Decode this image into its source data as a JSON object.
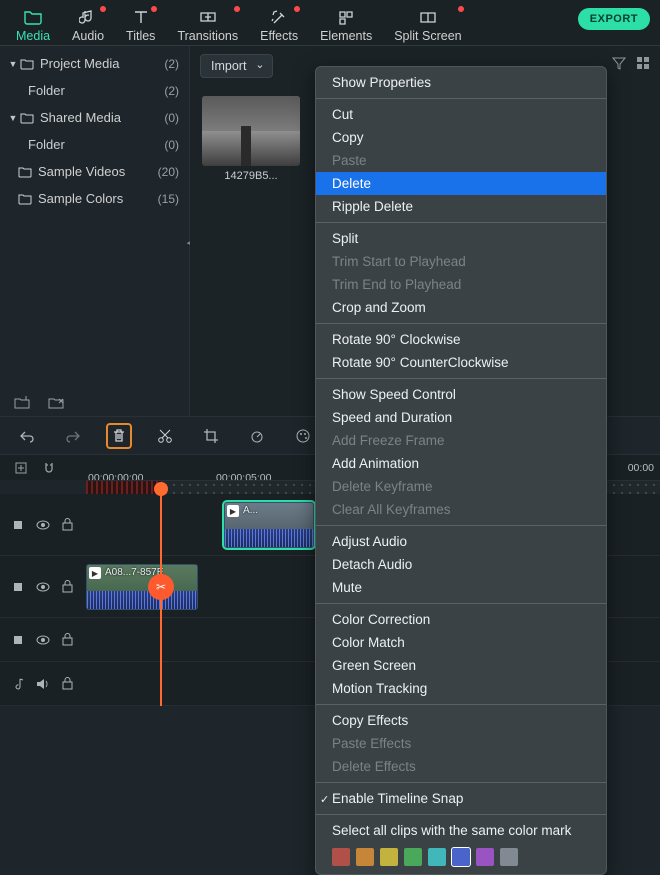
{
  "top": {
    "tabs": [
      {
        "label": "Media",
        "active": true,
        "dot": false
      },
      {
        "label": "Audio",
        "active": false,
        "dot": true
      },
      {
        "label": "Titles",
        "active": false,
        "dot": true
      },
      {
        "label": "Transitions",
        "active": false,
        "dot": true
      },
      {
        "label": "Effects",
        "active": false,
        "dot": true
      },
      {
        "label": "Elements",
        "active": false,
        "dot": false
      },
      {
        "label": "Split Screen",
        "active": false,
        "dot": true
      }
    ],
    "export": "EXPORT"
  },
  "sidebar": {
    "rows": [
      {
        "type": "group",
        "name": "Project Media",
        "count": "(2)"
      },
      {
        "type": "child",
        "name": "Folder",
        "count": "(2)"
      },
      {
        "type": "group",
        "name": "Shared Media",
        "count": "(0)"
      },
      {
        "type": "child",
        "name": "Folder",
        "count": "(0)"
      },
      {
        "type": "item",
        "name": "Sample Videos",
        "count": "(20)"
      },
      {
        "type": "item",
        "name": "Sample Colors",
        "count": "(15)"
      }
    ]
  },
  "content": {
    "import": "Import",
    "thumb": "14279B5..."
  },
  "ruler": {
    "start": "00:00:00:00",
    "mid": "00:00:05:00",
    "far": "00:00"
  },
  "clips": {
    "top_label": "A...",
    "bottom_label": "A08...7-857E"
  },
  "ctx": {
    "groups": [
      [
        {
          "t": "Show Properties"
        }
      ],
      [
        {
          "t": "Cut"
        },
        {
          "t": "Copy"
        },
        {
          "t": "Paste",
          "d": true
        },
        {
          "t": "Delete",
          "hl": true
        },
        {
          "t": "Ripple Delete"
        }
      ],
      [
        {
          "t": "Split"
        },
        {
          "t": "Trim Start to Playhead",
          "d": true
        },
        {
          "t": "Trim End to Playhead",
          "d": true
        },
        {
          "t": "Crop and Zoom"
        }
      ],
      [
        {
          "t": "Rotate 90° Clockwise"
        },
        {
          "t": "Rotate 90° CounterClockwise"
        }
      ],
      [
        {
          "t": "Show Speed Control"
        },
        {
          "t": "Speed and Duration"
        },
        {
          "t": "Add Freeze Frame",
          "d": true
        },
        {
          "t": "Add Animation"
        },
        {
          "t": "Delete Keyframe",
          "d": true
        },
        {
          "t": "Clear All Keyframes",
          "d": true
        }
      ],
      [
        {
          "t": "Adjust Audio"
        },
        {
          "t": "Detach Audio"
        },
        {
          "t": "Mute"
        }
      ],
      [
        {
          "t": "Color Correction"
        },
        {
          "t": "Color Match"
        },
        {
          "t": "Green Screen"
        },
        {
          "t": "Motion Tracking"
        }
      ],
      [
        {
          "t": "Copy Effects"
        },
        {
          "t": "Paste Effects",
          "d": true
        },
        {
          "t": "Delete Effects",
          "d": true
        }
      ],
      [
        {
          "t": "Enable Timeline Snap",
          "chk": true
        }
      ]
    ],
    "color_label": "Select all clips with the same color mark",
    "colors": [
      "#b05048",
      "#c6863a",
      "#c4b23f",
      "#4aa85a",
      "#3fb7bb",
      "#4b64c9",
      "#9a54c2",
      "#818a92"
    ],
    "color_selected": 5
  }
}
